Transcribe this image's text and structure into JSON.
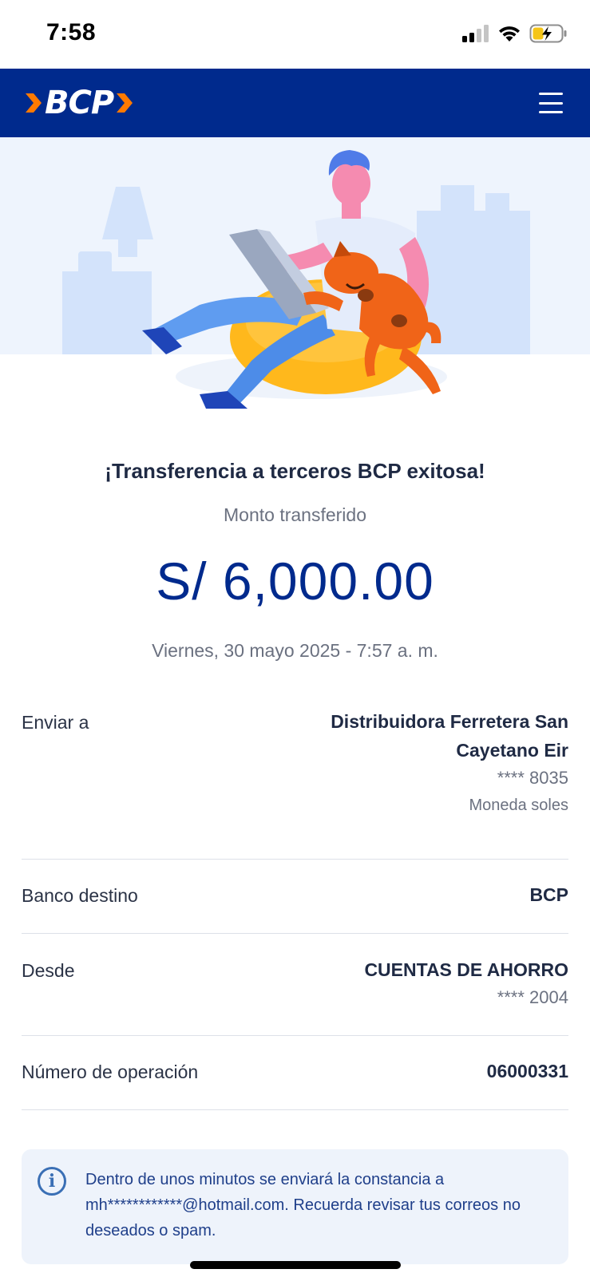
{
  "status_bar": {
    "time": "7:58"
  },
  "header": {
    "logo_text": "BCP",
    "brand_color": "#002a8d",
    "accent_color": "#ff7a00"
  },
  "result": {
    "title": "¡Transferencia a terceros BCP exitosa!",
    "amount_label": "Monto transferido",
    "amount": "S/ 6,000.00",
    "datetime": "Viernes, 30 mayo 2025 - 7:57 a. m."
  },
  "details": {
    "send_to": {
      "label": "Enviar a",
      "name_line1": "Distribuidora Ferretera San",
      "name_line2": "Cayetano Eir",
      "account": "**** 8035",
      "currency": "Moneda soles"
    },
    "bank": {
      "label": "Banco destino",
      "value": "BCP"
    },
    "from": {
      "label": "Desde",
      "value": "CUENTAS DE AHORRO",
      "account": "**** 2004"
    },
    "operation": {
      "label": "Número de operación",
      "value": "06000331"
    }
  },
  "info": {
    "icon": "info-icon",
    "text": "Dentro de unos minutos se enviará la constancia a mh************@hotmail.com. Recuerda revisar tus correos no deseados o spam."
  }
}
